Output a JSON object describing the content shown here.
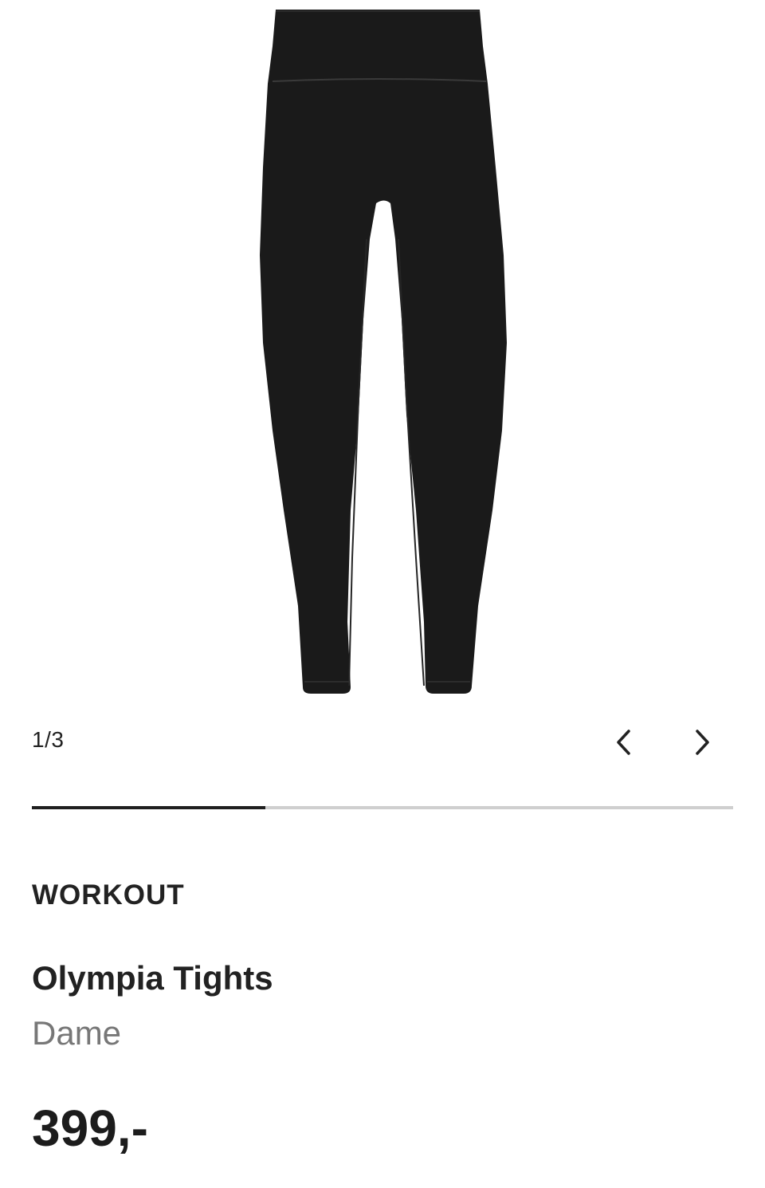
{
  "gallery": {
    "counter": "1/3",
    "current_index": 1,
    "total": 3,
    "progress_fraction": 0.333,
    "image": "black-leggings-product-photo",
    "prev_icon": "chevron-left-icon",
    "next_icon": "chevron-right-icon"
  },
  "product": {
    "brand": "WORKOUT",
    "name": "Olympia Tights",
    "gender": "Dame",
    "price": "399,-"
  },
  "colors": {
    "product": "#1a1a1a",
    "text": "#222222",
    "muted_text": "#777777",
    "progress_track": "#cfcfcf",
    "progress_fill": "#1f1f1f"
  }
}
